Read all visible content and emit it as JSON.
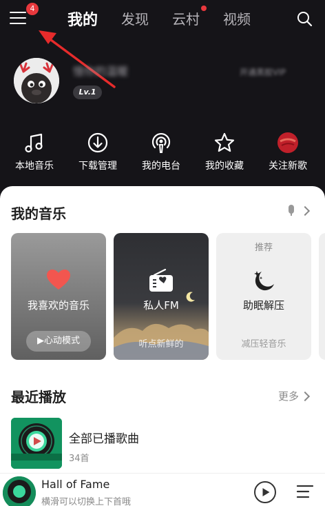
{
  "header": {
    "menu_badge": "4",
    "tabs": [
      "我的",
      "发现",
      "云村",
      "视频"
    ]
  },
  "user": {
    "name": "憶你的温暖",
    "level": "Lv.1",
    "vip_text": "开通黑胶VIP"
  },
  "quick_actions": [
    "本地音乐",
    "下载管理",
    "我的电台",
    "我的收藏",
    "关注新歌"
  ],
  "my_music": {
    "title": "我的音乐",
    "cards": [
      {
        "title": "我喜欢的音乐",
        "button": "▶心动模式"
      },
      {
        "title": "私人FM",
        "subtitle": "听点新鲜的"
      },
      {
        "tag": "推荐",
        "title": "助眠解压",
        "subtitle": "减压轻音乐"
      }
    ]
  },
  "recent": {
    "title": "最近播放",
    "more": "更多",
    "items": [
      {
        "title": "全部已播歌曲",
        "count": "34首"
      }
    ]
  },
  "player": {
    "song": "Hall of Fame",
    "hint": "横滑可以切换上下首哦"
  },
  "colors": {
    "accent_red": "#e8383d",
    "dark_bg": "#151418",
    "heart_red": "#f2564f"
  }
}
